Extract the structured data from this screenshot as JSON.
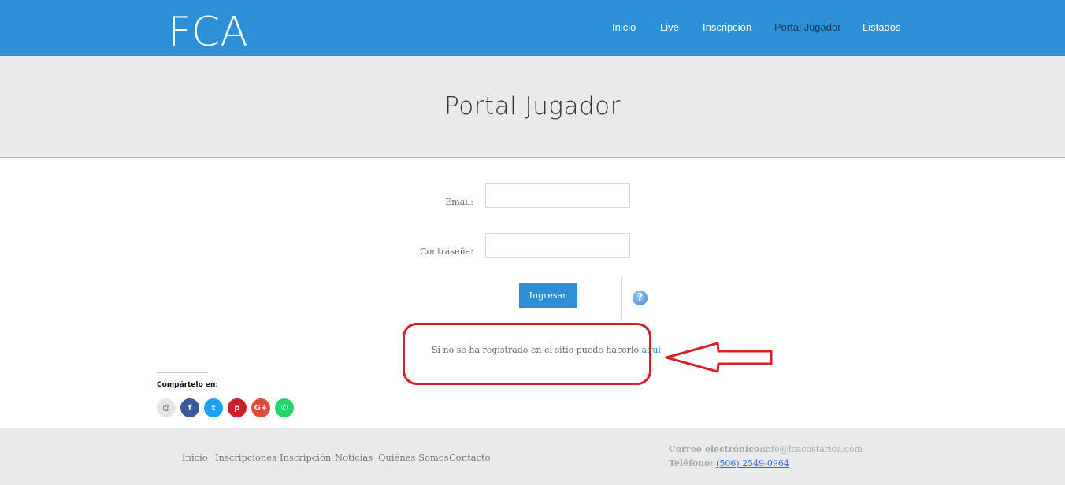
{
  "header": {
    "logo_text": "FCA",
    "nav": [
      {
        "label": "Inicio",
        "active": false
      },
      {
        "label": "Live",
        "active": false
      },
      {
        "label": "Inscripción",
        "active": false
      },
      {
        "label": "Portal Jugador",
        "active": true
      },
      {
        "label": "Listados",
        "active": false
      }
    ]
  },
  "banner": {
    "title": "Portal Jugador"
  },
  "form": {
    "email_label": "Email:",
    "email_value": "",
    "password_label": "Contraseña:",
    "password_value": "",
    "submit_label": "Ingresar",
    "help_icon": "?"
  },
  "register": {
    "text": "Si no se ha registrado en el sitio puede hacerlo",
    "link_label": "aqui"
  },
  "share": {
    "label": "Compártelo en:",
    "buttons": [
      {
        "name": "print-icon",
        "glyph": "⎙",
        "color": "#e5e5e5",
        "fg": "#777"
      },
      {
        "name": "facebook-icon",
        "glyph": "f",
        "color": "#3b5998",
        "fg": "#fff"
      },
      {
        "name": "twitter-icon",
        "glyph": "t",
        "color": "#1da1f2",
        "fg": "#fff"
      },
      {
        "name": "pinterest-icon",
        "glyph": "p",
        "color": "#cb2027",
        "fg": "#fff"
      },
      {
        "name": "googleplus-icon",
        "glyph": "G+",
        "color": "#dd4b39",
        "fg": "#fff"
      },
      {
        "name": "whatsapp-icon",
        "glyph": "✆",
        "color": "#25d366",
        "fg": "#fff"
      }
    ]
  },
  "footer": {
    "nav": [
      "Inicio",
      "Inscripciones",
      "Inscripción",
      "Noticias",
      "Quiénes Somos",
      "Contacto"
    ],
    "email_label": "Correo electrónico:",
    "email_value": "info@fcacostarica.com",
    "phone_label": "Teléfono:",
    "phone_value": "(506) 2549-0964"
  },
  "colors": {
    "brand_blue": "#2d8fd5",
    "banner_gray": "#e9eaec",
    "annotation_red": "#d61f26"
  }
}
